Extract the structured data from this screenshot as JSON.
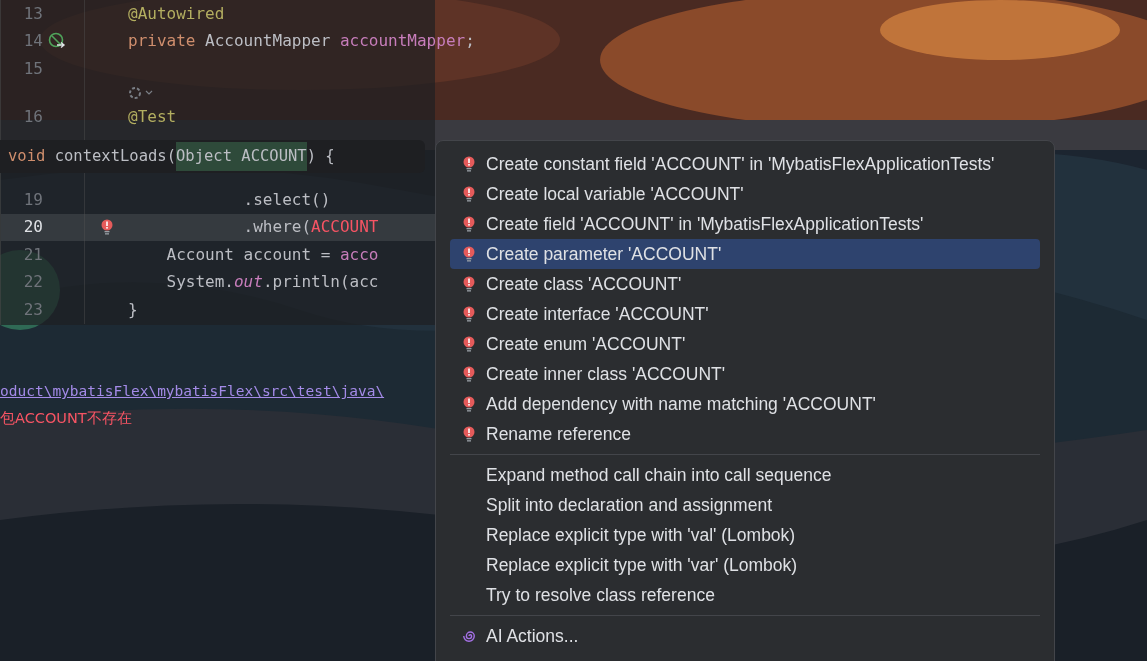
{
  "editor": {
    "lines": [
      {
        "kind": "code",
        "number": "13",
        "current": false,
        "tokens": [
          {
            "text": "@Autowired",
            "kind": "annotation"
          }
        ]
      },
      {
        "kind": "bean",
        "number": "14",
        "current": false,
        "tokens": [
          {
            "text": "private ",
            "kind": "keyword"
          },
          {
            "text": "AccountMapper ",
            "kind": "plain"
          },
          {
            "text": "accountMapper",
            "kind": "field"
          },
          {
            "text": ";",
            "kind": "plain"
          }
        ]
      },
      {
        "kind": "code",
        "number": "15",
        "current": false
      },
      {
        "kind": "inlay"
      },
      {
        "kind": "code",
        "number": "16",
        "current": false,
        "tokens": [
          {
            "text": "@Test",
            "kind": "annotation"
          }
        ]
      },
      {
        "kind": "hidden"
      },
      {
        "kind": "hidden"
      },
      {
        "kind": "code",
        "number": "19",
        "current": false,
        "tokens": [
          {
            "text": "            .select()",
            "kind": "plain"
          }
        ]
      },
      {
        "kind": "error",
        "number": "20",
        "current": true,
        "tokens": [
          {
            "text": "            .where(",
            "kind": "plain"
          },
          {
            "text": "ACCOUNT",
            "kind": "error"
          }
        ]
      },
      {
        "kind": "code",
        "number": "21",
        "current": false,
        "tokens": [
          {
            "text": "    Account account = ",
            "kind": "plain"
          },
          {
            "text": "acco",
            "kind": "field"
          }
        ]
      },
      {
        "kind": "code",
        "number": "22",
        "current": false,
        "tokens": [
          {
            "text": "    System.",
            "kind": "plain"
          },
          {
            "text": "out",
            "kind": "static"
          },
          {
            "text": ".println(acc",
            "kind": "plain"
          }
        ]
      },
      {
        "kind": "code",
        "number": "23",
        "current": false,
        "tokens": [
          {
            "text": "}",
            "kind": "plain"
          }
        ]
      }
    ]
  },
  "hint": {
    "tokens": [
      {
        "text": "void",
        "kind": "keyword"
      },
      {
        "text": " contextLoads(",
        "kind": "plain"
      },
      {
        "text": "Object ACCOUNT",
        "kind": "highlight"
      },
      {
        "text": ") {",
        "kind": "plain"
      }
    ]
  },
  "console": {
    "link": "oduct\\mybatisFlex\\mybatisFlex\\src\\test\\java\\",
    "error": "包ACCOUNT不存在"
  },
  "menu": {
    "groups": [
      [
        {
          "label": "Create constant field 'ACCOUNT' in 'MybatisFlexApplicationTests'",
          "kind": "fix",
          "selected": false
        },
        {
          "label": "Create local variable 'ACCOUNT'",
          "kind": "fix",
          "selected": false
        },
        {
          "label": "Create field 'ACCOUNT' in 'MybatisFlexApplicationTests'",
          "kind": "fix",
          "selected": false
        },
        {
          "label": "Create parameter 'ACCOUNT'",
          "kind": "fix",
          "selected": true
        },
        {
          "label": "Create class 'ACCOUNT'",
          "kind": "fix",
          "selected": false
        },
        {
          "label": "Create interface 'ACCOUNT'",
          "kind": "fix",
          "selected": false
        },
        {
          "label": "Create enum 'ACCOUNT'",
          "kind": "fix",
          "selected": false
        },
        {
          "label": "Create inner class 'ACCOUNT'",
          "kind": "fix",
          "selected": false
        },
        {
          "label": "Add dependency with name matching 'ACCOUNT'",
          "kind": "fix",
          "selected": false
        },
        {
          "label": "Rename reference",
          "kind": "fix",
          "selected": false
        }
      ],
      [
        {
          "label": "Expand method call chain into call sequence",
          "kind": "plain",
          "selected": false
        },
        {
          "label": "Split into declaration and assignment",
          "kind": "plain",
          "selected": false
        },
        {
          "label": "Replace explicit type with 'val' (Lombok)",
          "kind": "plain",
          "selected": false
        },
        {
          "label": "Replace explicit type with 'var' (Lombok)",
          "kind": "plain",
          "selected": false
        },
        {
          "label": "Try to resolve class reference",
          "kind": "plain",
          "selected": false
        }
      ],
      [
        {
          "label": "AI Actions...",
          "kind": "ai",
          "selected": false
        }
      ]
    ]
  }
}
